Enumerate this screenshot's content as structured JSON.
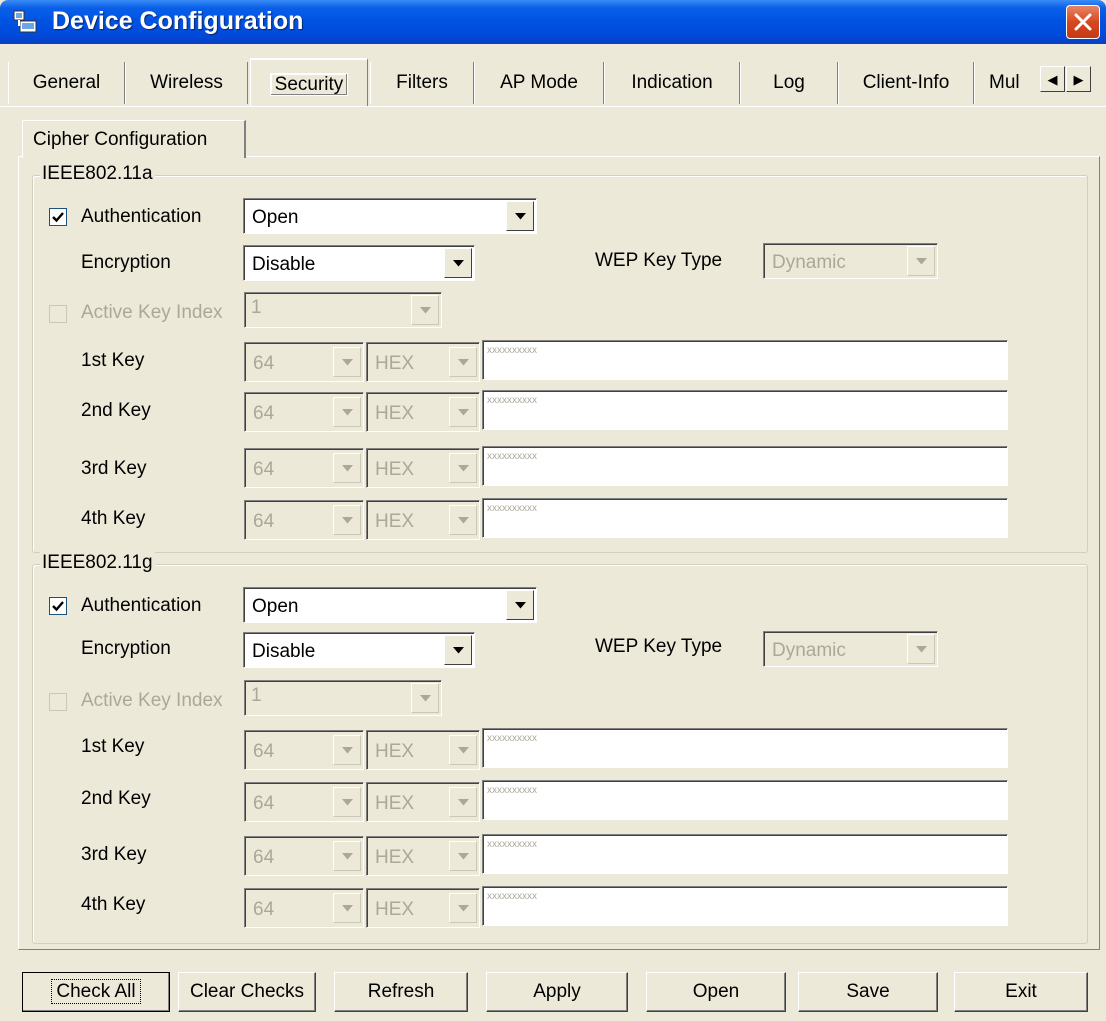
{
  "window": {
    "title": "Device Configuration"
  },
  "tabs": [
    "General",
    "Wireless",
    "Security",
    "Filters",
    "AP Mode",
    "Indication",
    "Log",
    "Client-Info",
    "Mul"
  ],
  "active_tab": "Security",
  "subtab": "Cipher Configuration",
  "groups": [
    {
      "title": "IEEE802.11a",
      "authentication_label": "Authentication",
      "authentication_checked": true,
      "authentication_value": "Open",
      "encryption_label": "Encryption",
      "encryption_value": "Disable",
      "wep_key_type_label": "WEP Key Type",
      "wep_key_type_value": "Dynamic",
      "active_key_index_label": "Active Key Index",
      "active_key_index_value": "1",
      "keys": [
        {
          "label": "1st Key",
          "size": "64",
          "format": "HEX",
          "value": "xxxxxxxxxx"
        },
        {
          "label": "2nd Key",
          "size": "64",
          "format": "HEX",
          "value": "xxxxxxxxxx"
        },
        {
          "label": "3rd Key",
          "size": "64",
          "format": "HEX",
          "value": "xxxxxxxxxx"
        },
        {
          "label": "4th Key",
          "size": "64",
          "format": "HEX",
          "value": "xxxxxxxxxx"
        }
      ]
    },
    {
      "title": "IEEE802.11g",
      "authentication_label": "Authentication",
      "authentication_checked": true,
      "authentication_value": "Open",
      "encryption_label": "Encryption",
      "encryption_value": "Disable",
      "wep_key_type_label": "WEP Key Type",
      "wep_key_type_value": "Dynamic",
      "active_key_index_label": "Active Key Index",
      "active_key_index_value": "1",
      "keys": [
        {
          "label": "1st Key",
          "size": "64",
          "format": "HEX",
          "value": "xxxxxxxxxx"
        },
        {
          "label": "2nd Key",
          "size": "64",
          "format": "HEX",
          "value": "xxxxxxxxxx"
        },
        {
          "label": "3rd Key",
          "size": "64",
          "format": "HEX",
          "value": "xxxxxxxxxx"
        },
        {
          "label": "4th Key",
          "size": "64",
          "format": "HEX",
          "value": "xxxxxxxxxx"
        }
      ]
    }
  ],
  "buttons": {
    "check_all": "Check All",
    "clear_checks": "Clear Checks",
    "refresh": "Refresh",
    "apply": "Apply",
    "open": "Open",
    "save": "Save",
    "exit": "Exit"
  },
  "colors": {
    "title_bar": "#0054E3",
    "dialog_bg": "#ECE9D8",
    "close_button": "#D6481F",
    "disabled_text": "#ACA899"
  }
}
